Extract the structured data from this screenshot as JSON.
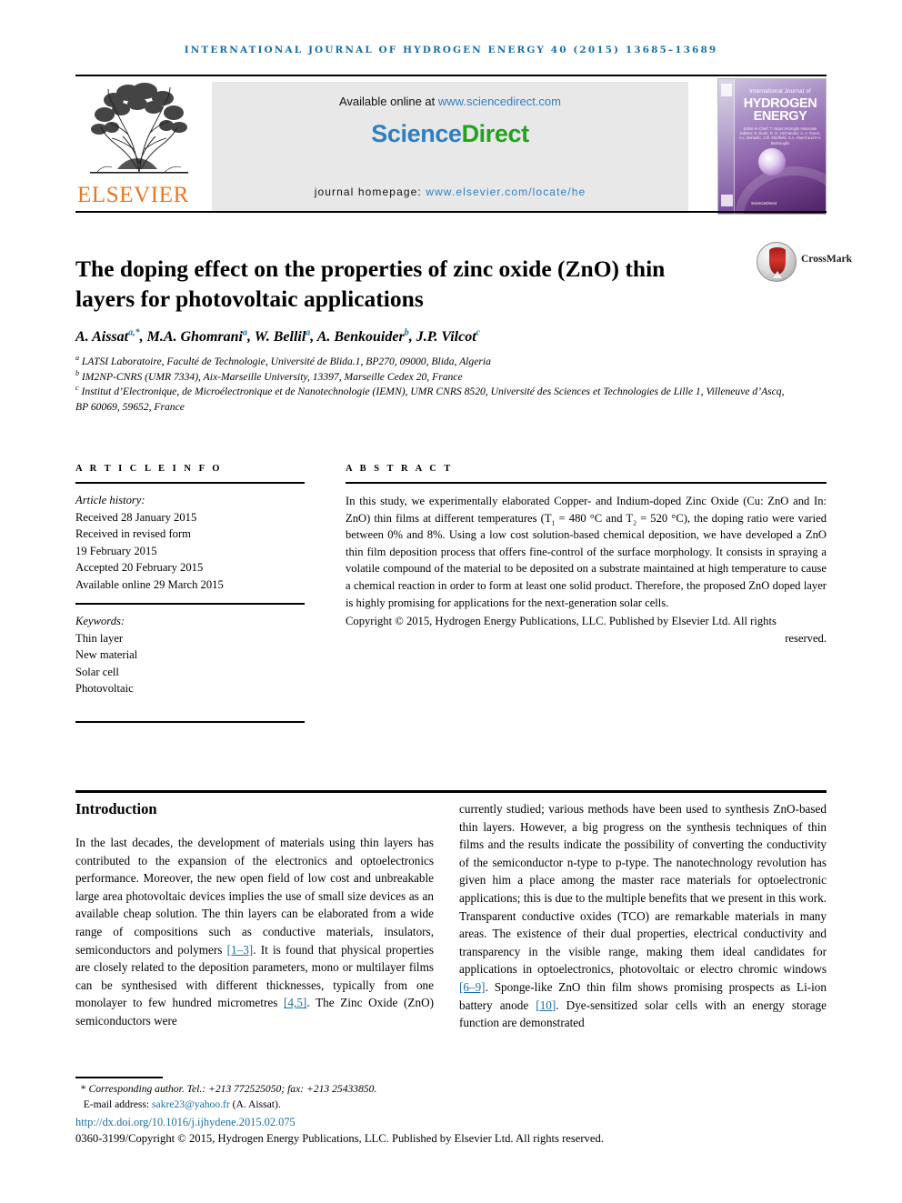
{
  "running_head": "INTERNATIONAL JOURNAL OF HYDROGEN ENERGY 40 (2015) 13685–13689",
  "masthead": {
    "publisher_name": "ELSEVIER",
    "available_prefix": "Available online at ",
    "available_url": "www.sciencedirect.com",
    "brand_first": "Science",
    "brand_second": "Direct",
    "homepage_label": "journal homepage: ",
    "homepage_url": "www.elsevier.com/locate/he",
    "cover": {
      "top_line": "International Journal of",
      "title_line1": "HYDROGEN",
      "title_line2": "ENERGY",
      "editors": "Editor-in-Chief:  T. Nejat Veziroglu\nAssociate Editors:  S. Dunn, D. G. Hernandez, A. A. Evers,\nA.L. Bonadio, J.W. Sheffield,\nS.A. Sherif and P.A. Bertrangllo",
      "sd_mark": "ScienceDirect",
      "available_online": "Available online at www.sciencedirect.com"
    }
  },
  "title": "The doping effect on the properties of zinc oxide (ZnO) thin layers for photovoltaic applications",
  "crossmark_label": "CrossMark",
  "authors": [
    {
      "name": "A. Aissat",
      "marks": "a,*"
    },
    {
      "name": "M.A. Ghomrani",
      "marks": "a"
    },
    {
      "name": "W. Bellil",
      "marks": "a"
    },
    {
      "name": "A. Benkouider",
      "marks": "b"
    },
    {
      "name": "J.P. Vilcot",
      "marks": "c"
    }
  ],
  "affiliations": [
    {
      "mark": "a",
      "text": "LATSI Laboratoire, Faculté de Technologie, Université de Blida.1, BP270, 09000, Blida, Algeria"
    },
    {
      "mark": "b",
      "text": "IM2NP-CNRS (UMR 7334), Aix-Marseille University, 13397, Marseille Cedex 20, France"
    },
    {
      "mark": "c",
      "text": "Institut d’Electronique, de Microélectronique et de Nanotechnologie (IEMN), UMR CNRS 8520, Université des Sciences et Technologies de Lille 1, Villeneuve d’Ascq, BP 60069, 59652, France"
    }
  ],
  "article_info": {
    "heading": "A R T I C L E  I N F O",
    "history_label": "Article history:",
    "history": [
      "Received 28 January 2015",
      "Received in revised form",
      "19 February 2015",
      "Accepted 20 February 2015",
      "Available online 29 March 2015"
    ],
    "keywords_label": "Keywords:",
    "keywords": [
      "Thin layer",
      "New material",
      "Solar cell",
      "Photovoltaic"
    ]
  },
  "abstract": {
    "heading": "A B S T R A C T",
    "part1": "In this study, we experimentally elaborated Copper- and Indium-doped Zinc Oxide (Cu: ZnO and In: ZnO) thin films at different temperatures (T",
    "t1_sub": "1",
    "part2": " = 480 °C and T",
    "t2_sub": "2",
    "part3": " = 520 °C), the doping ratio were varied between 0% and 8%. Using a low cost solution-based chemical deposition, we have developed a ZnO thin film deposition process that offers fine-control of the surface morphology. It consists in spraying a volatile compound of the material to be deposited on a substrate maintained at high temperature to cause a chemical reaction in order to form at least one solid product. Therefore, the proposed ZnO doped layer is highly promising for applications for the next-generation solar cells.",
    "copyright_main": "Copyright © 2015, Hydrogen Energy Publications, LLC. Published by Elsevier Ltd. All rights",
    "copyright_tail": "reserved."
  },
  "body": {
    "heading": "Introduction",
    "left_paragraph_a": "In the last decades, the development of materials using thin layers has contributed to the expansion of the electronics and optoelectronics performance. Moreover, the new open field of low cost and unbreakable large area photovoltaic devices implies the use of small size devices as an available cheap solution. The thin layers can be elaborated from a wide range of compositions such as conductive materials, insulators, semiconductors and polymers ",
    "ref_1_3": "[1–3]",
    "left_paragraph_b": ". It is found that physical properties are closely related to the deposition parameters, mono or multilayer films can be synthesised with different thicknesses, typically from one monolayer to few hundred micrometres ",
    "ref_4_5": "[4,5]",
    "left_paragraph_c": ". The Zinc Oxide (ZnO) semiconductors were",
    "right_paragraph_a": "currently studied; various methods have been used to synthesis ZnO-based thin layers. However, a big progress on the synthesis techniques of thin films and the results indicate the possibility of converting the conductivity of the semiconductor n-type to p-type. The nanotechnology revolution has given him a place among the master race materials for optoelectronic applications; this is due to the multiple benefits that we present in this work. Transparent conductive oxides (TCO) are remarkable materials in many areas. The existence of their dual properties, electrical conductivity and transparency in the visible range, making them ideal candidates for applications in optoelectronics, photovoltaic or electro chromic windows ",
    "ref_6_9": "[6–9]",
    "right_paragraph_b": ". Sponge-like ZnO thin film shows promising prospects as Li-ion battery anode ",
    "ref_10": "[10]",
    "right_paragraph_c": ". Dye-sensitized solar cells with an energy storage function are demonstrated"
  },
  "footer": {
    "corresponding": "Corresponding author. Tel.: +213 772525050; fax: +213 25433850.",
    "email_label": "E-mail address: ",
    "email": "sakre23@yahoo.fr",
    "email_suffix": " (A. Aissat).",
    "doi": "http://dx.doi.org/10.1016/j.ijhydene.2015.02.075",
    "issn_line": "0360-3199/Copyright © 2015, Hydrogen Energy Publications, LLC. Published by Elsevier Ltd. All rights reserved."
  },
  "colors": {
    "link_blue": "#1a6fa3",
    "science_blue": "#2f7fc1",
    "direct_green": "#22a21f",
    "elsevier_orange": "#e87722"
  }
}
